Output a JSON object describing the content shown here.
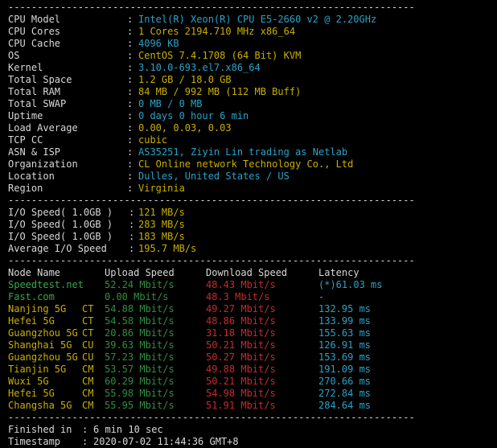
{
  "separator": "----------------------------------------------------------------------",
  "sysinfo": [
    {
      "label": "CPU Model",
      "value": "Intel(R) Xeon(R) CPU E5-2660 v2 @ 2.20GHz",
      "color": "cyan"
    },
    {
      "label": "CPU Cores",
      "value": "1 Cores 2194.710 MHz x86_64",
      "color": "yellow"
    },
    {
      "label": "CPU Cache",
      "value": "4096 KB",
      "color": "cyan"
    },
    {
      "label": "OS",
      "value": "CentOS 7.4.1708 (64 Bit) KVM",
      "color": "yellow"
    },
    {
      "label": "Kernel",
      "value": "3.10.0-693.el7.x86_64",
      "color": "cyan"
    },
    {
      "label": "Total Space",
      "value": "1.2 GB / 18.0 GB",
      "color": "yellow"
    },
    {
      "label": "Total RAM",
      "value": "84 MB / 992 MB (112 MB Buff)",
      "color": "yellow"
    },
    {
      "label": "Total SWAP",
      "value": "0 MB / 0 MB",
      "color": "cyan"
    },
    {
      "label": "Uptime",
      "value": "0 days 0 hour 6 min",
      "color": "cyan"
    },
    {
      "label": "Load Average",
      "value": "0.00, 0.03, 0.03",
      "color": "yellow"
    },
    {
      "label": "TCP CC",
      "value": "cubic",
      "color": "yellow"
    },
    {
      "label": "ASN & ISP",
      "value": "AS35251, Ziyin Lin trading as Netlab",
      "color": "cyan"
    },
    {
      "label": "Organization",
      "value": "CL Online network Technology Co., Ltd",
      "color": "yellow"
    },
    {
      "label": "Location",
      "value": "Dulles, United States / US",
      "color": "cyan"
    },
    {
      "label": "Region",
      "value": "Virginia",
      "color": "yellow"
    }
  ],
  "io": [
    {
      "label": "I/O Speed( 1.0GB )",
      "value": "121 MB/s"
    },
    {
      "label": "I/O Speed( 1.0GB )",
      "value": "283 MB/s"
    },
    {
      "label": "I/O Speed( 1.0GB )",
      "value": "183 MB/s"
    },
    {
      "label": "Average I/O Speed",
      "value": "195.7 MB/s"
    }
  ],
  "speed_header": {
    "node": "Node Name",
    "upload": "Upload Speed",
    "download": "Download Speed",
    "latency": "Latency"
  },
  "speed_rows": [
    {
      "node": "Speedtest.net",
      "isp": "",
      "upload": "52.24 Mbit/s",
      "download": "48.43 Mbit/s",
      "latency": "(*)61.03 ms",
      "style": "primary"
    },
    {
      "node": "Fast.com",
      "isp": "",
      "upload": "0.00 Mbit/s",
      "download": "48.3 Mbit/s",
      "latency": "-",
      "style": "primary"
    },
    {
      "node": "Nanjing 5G",
      "isp": "CT",
      "upload": "54.88 Mbit/s",
      "download": "49.27 Mbit/s",
      "latency": "132.95 ms",
      "style": "normal"
    },
    {
      "node": "Hefei 5G",
      "isp": "CT",
      "upload": "54.58 Mbit/s",
      "download": "48.86 Mbit/s",
      "latency": "133.99 ms",
      "style": "normal"
    },
    {
      "node": "Guangzhou 5G",
      "isp": "CT",
      "upload": "20.86 Mbit/s",
      "download": "31.18 Mbit/s",
      "latency": "155.63 ms",
      "style": "normal"
    },
    {
      "node": "Shanghai 5G",
      "isp": "CU",
      "upload": "39.63 Mbit/s",
      "download": "50.21 Mbit/s",
      "latency": "126.91 ms",
      "style": "normal"
    },
    {
      "node": "Guangzhou 5G",
      "isp": "CU",
      "upload": "57.23 Mbit/s",
      "download": "50.27 Mbit/s",
      "latency": "153.69 ms",
      "style": "normal"
    },
    {
      "node": "Tianjin 5G",
      "isp": "CM",
      "upload": "53.57 Mbit/s",
      "download": "49.88 Mbit/s",
      "latency": "191.09 ms",
      "style": "normal"
    },
    {
      "node": "Wuxi 5G",
      "isp": "CM",
      "upload": "60.29 Mbit/s",
      "download": "50.21 Mbit/s",
      "latency": "270.66 ms",
      "style": "normal"
    },
    {
      "node": "Hefei 5G",
      "isp": "CM",
      "upload": "55.98 Mbit/s",
      "download": "54.98 Mbit/s",
      "latency": "272.84 ms",
      "style": "normal"
    },
    {
      "node": "Changsha 5G",
      "isp": "CM",
      "upload": "55.95 Mbit/s",
      "download": "51.91 Mbit/s",
      "latency": "284.64 ms",
      "style": "normal"
    }
  ],
  "footer": [
    {
      "label": "Finished in",
      "value": "6 min 10 sec"
    },
    {
      "label": "Timestamp",
      "value": "2020-07-02 11:44:36 GMT+8"
    }
  ],
  "colors": {
    "background": "#000000",
    "text": "#d8d8d8",
    "cyan": "#2aa3c8",
    "yellow": "#c8b000",
    "green": "#35a84a",
    "red": "#c92a2a"
  }
}
